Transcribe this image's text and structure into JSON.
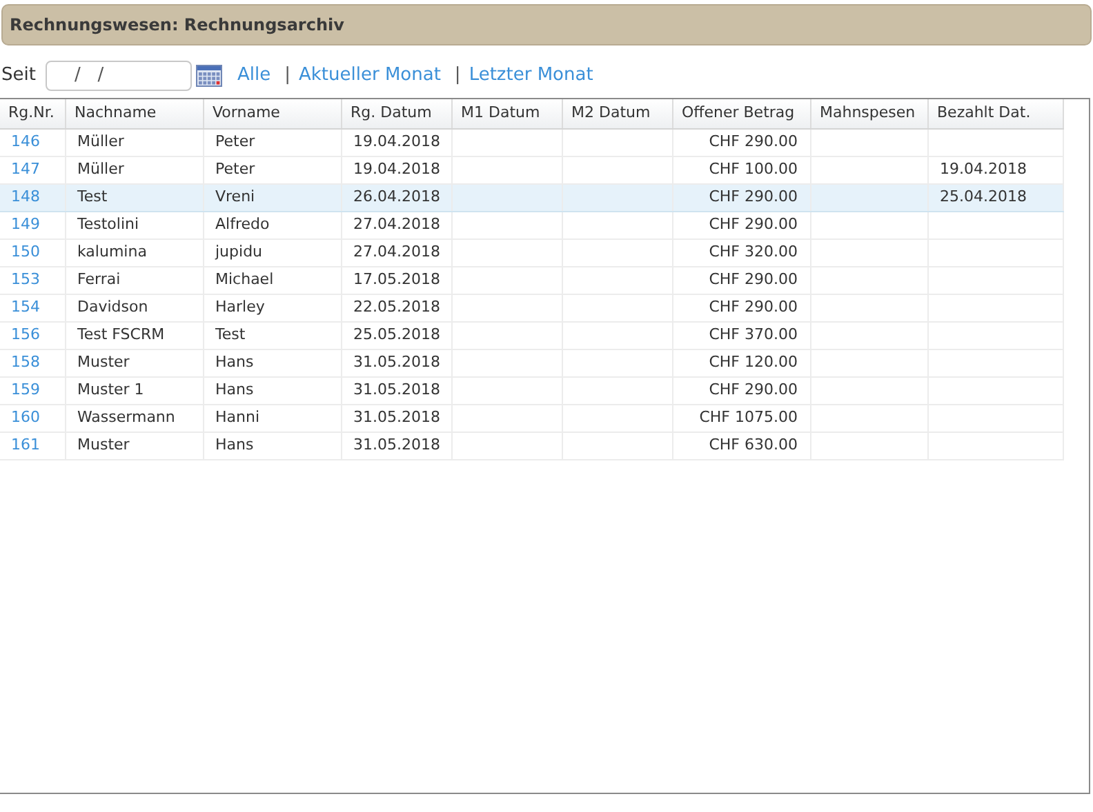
{
  "header": {
    "title": "Rechnungswesen: Rechnungsarchiv"
  },
  "filter": {
    "label": "Seit",
    "date_value": "/   /",
    "links": [
      {
        "text": "Alle"
      },
      {
        "text": "Aktueller Monat"
      },
      {
        "text": "Letzter Monat"
      }
    ],
    "separator": "|"
  },
  "table": {
    "columns": [
      "Rg.Nr.",
      "Nachname",
      "Vorname",
      "Rg. Datum",
      "M1 Datum",
      "M2 Datum",
      "Offener Betrag",
      "Mahnspesen",
      "Bezahlt Dat."
    ],
    "rows": [
      {
        "cells": [
          "146",
          "Müller",
          "Peter",
          "19.04.2018",
          "",
          "",
          "CHF 290.00",
          "",
          ""
        ],
        "selected": false
      },
      {
        "cells": [
          "147",
          "Müller",
          "Peter",
          "19.04.2018",
          "",
          "",
          "CHF 100.00",
          "",
          "19.04.2018"
        ],
        "selected": false
      },
      {
        "cells": [
          "148",
          "Test",
          "Vreni",
          "26.04.2018",
          "",
          "",
          "CHF 290.00",
          "",
          "25.04.2018"
        ],
        "selected": true
      },
      {
        "cells": [
          "149",
          "Testolini",
          "Alfredo",
          "27.04.2018",
          "",
          "",
          "CHF 290.00",
          "",
          ""
        ],
        "selected": false
      },
      {
        "cells": [
          "150",
          "kalumina",
          "jupidu",
          "27.04.2018",
          "",
          "",
          "CHF 320.00",
          "",
          ""
        ],
        "selected": false
      },
      {
        "cells": [
          "153",
          "Ferrai",
          "Michael",
          "17.05.2018",
          "",
          "",
          "CHF 290.00",
          "",
          ""
        ],
        "selected": false
      },
      {
        "cells": [
          "154",
          "Davidson",
          "Harley",
          "22.05.2018",
          "",
          "",
          "CHF 290.00",
          "",
          ""
        ],
        "selected": false
      },
      {
        "cells": [
          "156",
          "Test FSCRM",
          "Test",
          "25.05.2018",
          "",
          "",
          "CHF 370.00",
          "",
          ""
        ],
        "selected": false
      },
      {
        "cells": [
          "158",
          "Muster",
          "Hans",
          "31.05.2018",
          "",
          "",
          "CHF 120.00",
          "",
          ""
        ],
        "selected": false
      },
      {
        "cells": [
          "159",
          "Muster 1",
          "Hans",
          "31.05.2018",
          "",
          "",
          "CHF 290.00",
          "",
          ""
        ],
        "selected": false
      },
      {
        "cells": [
          "160",
          "Wassermann",
          "Hanni",
          "31.05.2018",
          "",
          "",
          "CHF 1075.00",
          "",
          ""
        ],
        "selected": false
      },
      {
        "cells": [
          "161",
          "Muster",
          "Hans",
          "31.05.2018",
          "",
          "",
          "CHF 630.00",
          "",
          ""
        ],
        "selected": false
      }
    ]
  }
}
